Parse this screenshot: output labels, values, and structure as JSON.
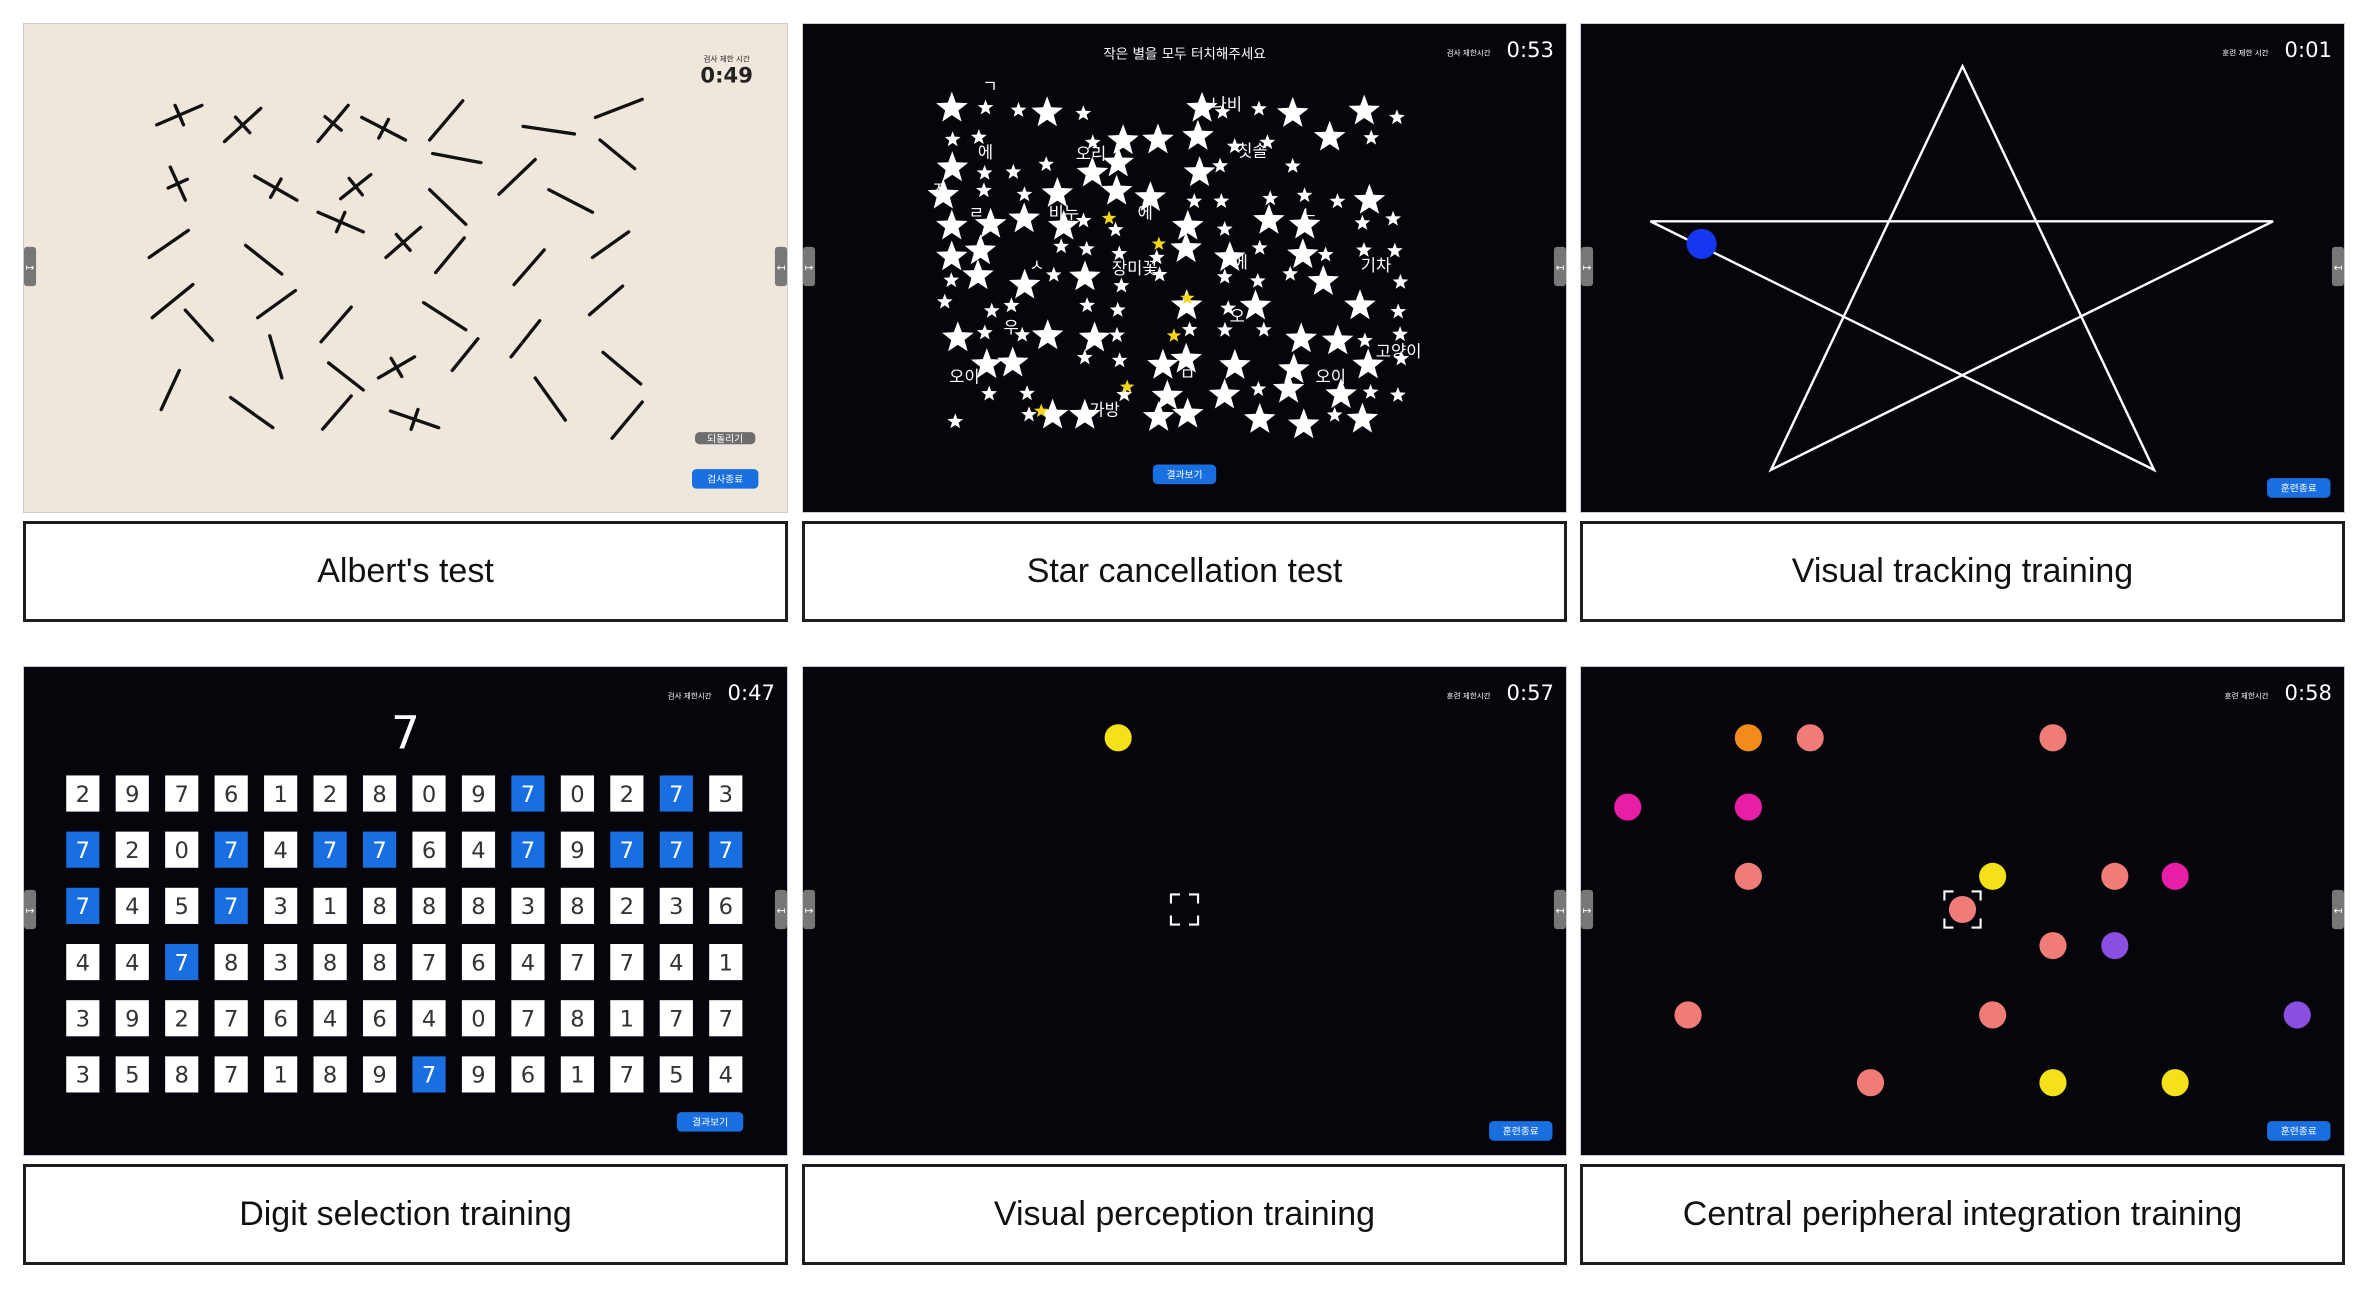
{
  "colors": {
    "dark_bg": "#05050b",
    "beige_bg": "#efe6dc",
    "accent_blue": "#1a6fe0",
    "gray_button": "#6d6d6d",
    "star_yellow": "#f2d51c",
    "tracking_dot": "#1636f0"
  },
  "albert": {
    "caption": "Albert's test",
    "timer_label": "검사 제한 시간",
    "timer": "0:49",
    "undo_label": "되돌리기",
    "end_label": "검사종료"
  },
  "star": {
    "caption": "Star cancellation test",
    "title": "작은 별을 모두 터치해주세요",
    "timer_label": "검사 제한시간",
    "timer": "0:53",
    "result_label": "결과보기",
    "words": [
      "나비",
      "에",
      "오리",
      "칫솔",
      "ㄱ",
      "ㅈ",
      "ㄹ",
      "비누",
      "에",
      "ㄴ",
      "장미꽃",
      "에",
      "기차",
      "ㅅ",
      "오",
      "우",
      "고양이",
      "오이",
      "ㅁ",
      "오이",
      "가방"
    ]
  },
  "tracking": {
    "caption": "Visual tracking training",
    "timer_label": "훈련 제한 시간",
    "timer": "0:01",
    "end_label": "훈련종료"
  },
  "digit": {
    "caption": "Digit selection training",
    "target": "7",
    "timer_label": "검사 제한시간",
    "timer": "0:47",
    "result_label": "결과보기",
    "grid": [
      [
        "2",
        "9",
        "7",
        "6",
        "1",
        "2",
        "8",
        "0",
        "9",
        "7",
        "0",
        "2",
        "7",
        "3"
      ],
      [
        "7",
        "2",
        "0",
        "7",
        "4",
        "7",
        "7",
        "6",
        "4",
        "7",
        "9",
        "7",
        "7",
        "7"
      ],
      [
        "7",
        "4",
        "5",
        "7",
        "3",
        "1",
        "8",
        "8",
        "8",
        "3",
        "8",
        "2",
        "3",
        "6"
      ],
      [
        "4",
        "4",
        "7",
        "8",
        "3",
        "8",
        "8",
        "7",
        "6",
        "4",
        "7",
        "7",
        "4",
        "1"
      ],
      [
        "3",
        "9",
        "2",
        "7",
        "6",
        "4",
        "6",
        "4",
        "0",
        "7",
        "8",
        "1",
        "7",
        "7"
      ],
      [
        "3",
        "5",
        "8",
        "7",
        "1",
        "8",
        "9",
        "7",
        "9",
        "6",
        "1",
        "7",
        "5",
        "4"
      ]
    ],
    "selected": [
      [
        0,
        9
      ],
      [
        0,
        12
      ],
      [
        1,
        0
      ],
      [
        1,
        3
      ],
      [
        1,
        5
      ],
      [
        1,
        6
      ],
      [
        1,
        9
      ],
      [
        1,
        11
      ],
      [
        1,
        12
      ],
      [
        1,
        13
      ],
      [
        2,
        0
      ],
      [
        2,
        3
      ],
      [
        3,
        2
      ],
      [
        5,
        7
      ]
    ]
  },
  "perception": {
    "caption": "Visual perception training",
    "timer_label": "훈련 제한시간",
    "timer": "0:57",
    "end_label": "훈련종료",
    "dot_color": "#f5e11a"
  },
  "central": {
    "caption": "Central peripheral integration training",
    "timer_label": "훈련 제한시간",
    "timer": "0:58",
    "end_label": "훈련종료",
    "dot_colors": [
      "#f28a1c",
      "#f07c78",
      "#f07c78",
      "#e81fa6",
      "#e81fa6",
      "#f07c78",
      "#f5e11a",
      "#f07c78",
      "#e81fa6",
      "#f07c78",
      "#f07c78",
      "#8a4fe0",
      "#f07c78",
      "#f07c78",
      "#8a4fe0",
      "#f07c78",
      "#f5e11a",
      "#f5e11a"
    ]
  }
}
